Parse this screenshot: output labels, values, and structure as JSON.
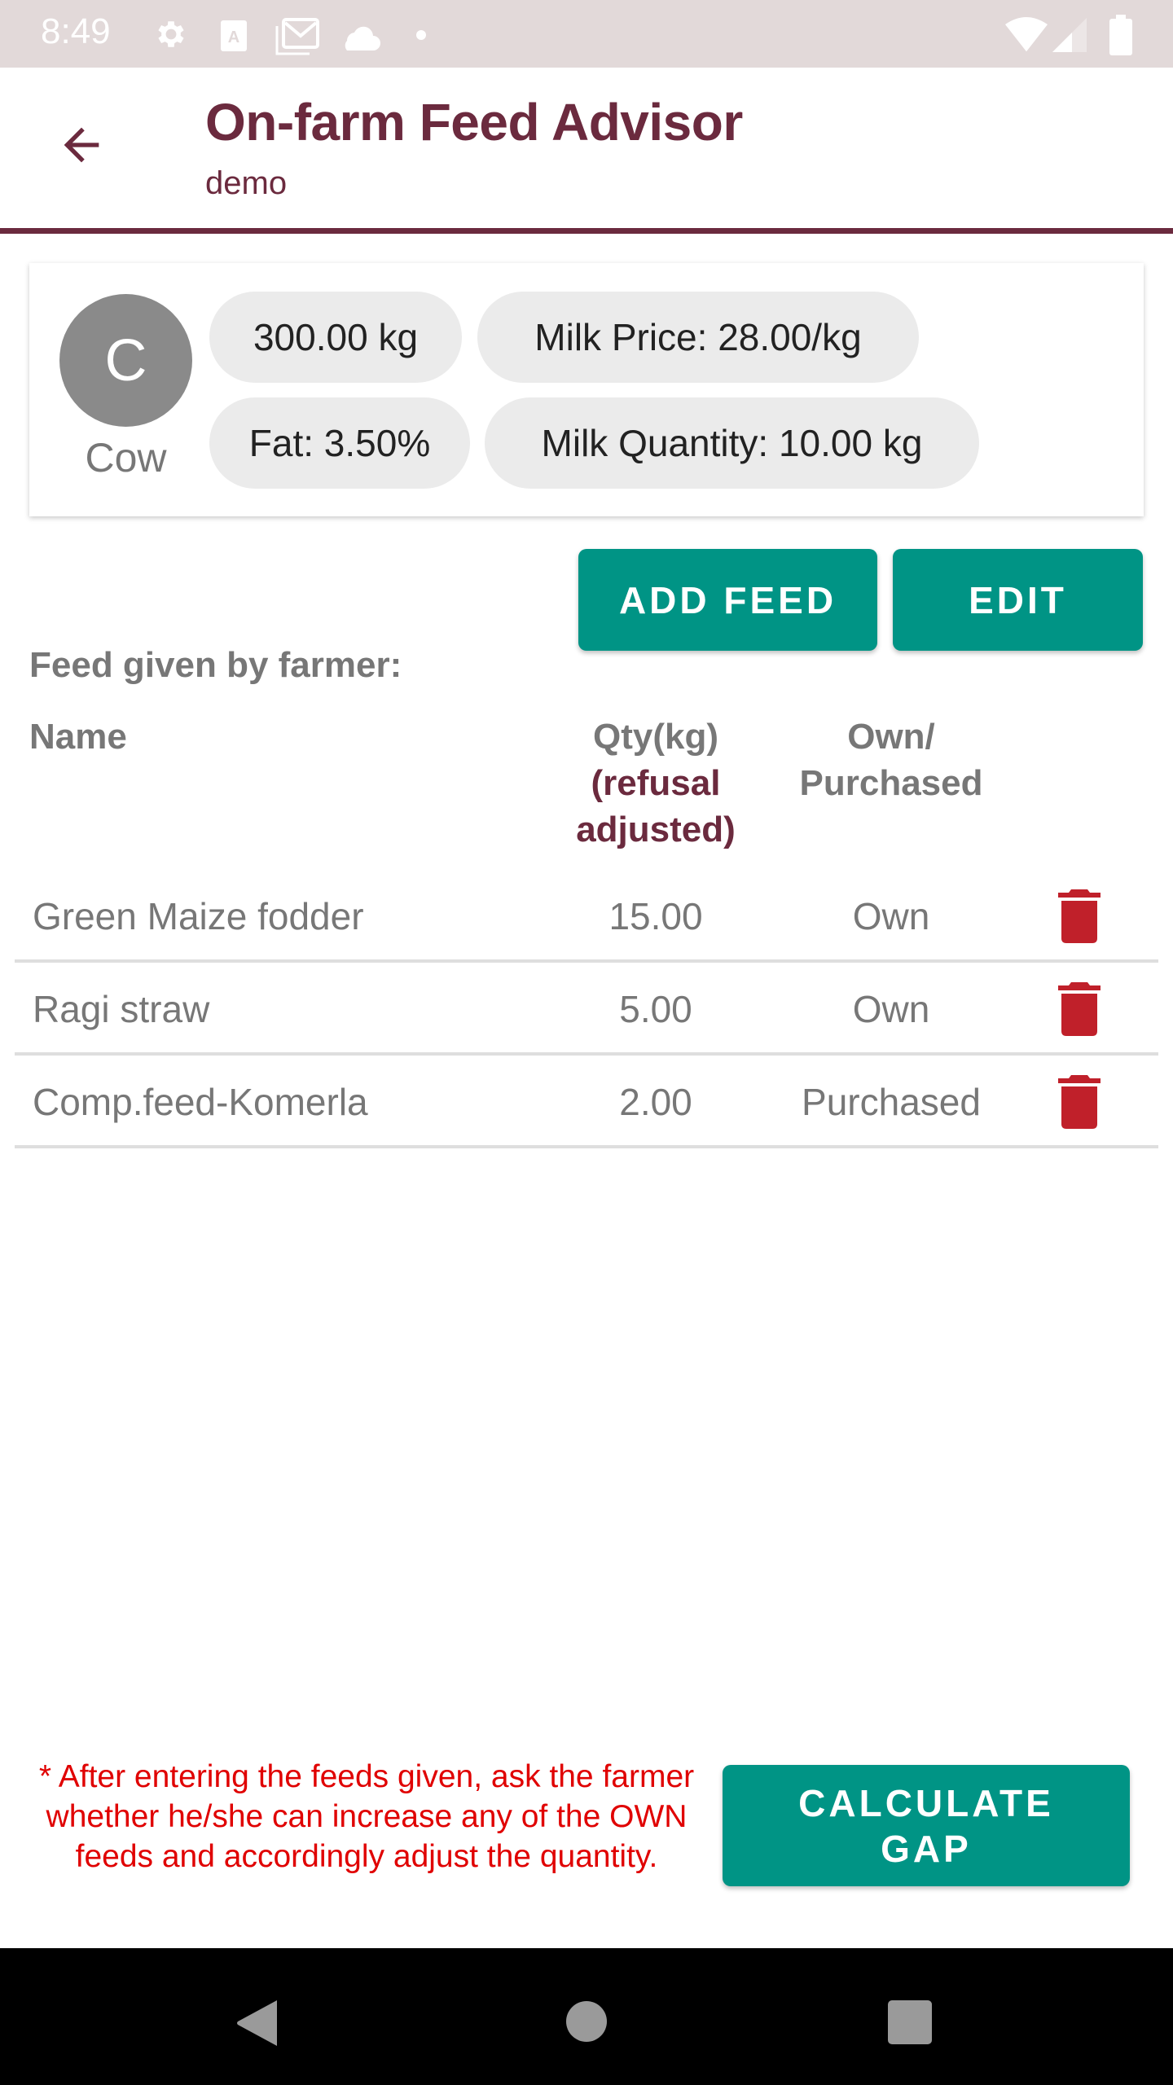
{
  "status_bar": {
    "time": "8:49",
    "left_icons": [
      "gear-icon",
      "keyboard-a-icon",
      "gmail-icon",
      "cloud-icon",
      "dot-icon"
    ],
    "right_icons": [
      "wifi-icon",
      "signal-icon",
      "battery-icon"
    ]
  },
  "header": {
    "title": "On-farm Feed Advisor",
    "subtitle": "demo",
    "back_icon": "arrow-back-icon",
    "accent_color": "#6b2a3e"
  },
  "animal_card": {
    "avatar_letter": "C",
    "animal_type": "Cow",
    "chips": {
      "weight": "300.00 kg",
      "milk_price": "Milk Price: 28.00/kg",
      "fat": "Fat: 3.50%",
      "milk_quantity": "Milk Quantity: 10.00 kg"
    }
  },
  "actions": {
    "add_feed": "ADD FEED",
    "edit": "EDIT",
    "calculate_gap": "CALCULATE GAP",
    "button_color": "#009485"
  },
  "feed_table": {
    "section_label": "Feed given by farmer:",
    "columns": {
      "name": "Name",
      "qty": "Qty(kg)",
      "qty_note": "(refusal adjusted)",
      "source": "Own/ Purchased"
    },
    "rows": [
      {
        "name": "Green Maize fodder",
        "qty": "15.00",
        "source": "Own"
      },
      {
        "name": "Ragi straw",
        "qty": "5.00",
        "source": "Own"
      },
      {
        "name": "Comp.feed-Komerla",
        "qty": "2.00",
        "source": "Purchased"
      }
    ],
    "delete_icon": "trash-icon",
    "delete_color": "#c0202a"
  },
  "note": "* After entering the feeds given, ask the farmer whether he/she can increase any of the OWN feeds and accordingly adjust the quantity.",
  "nav_bar": {
    "buttons": [
      "back-triangle-icon",
      "home-circle-icon",
      "recents-square-icon"
    ]
  }
}
